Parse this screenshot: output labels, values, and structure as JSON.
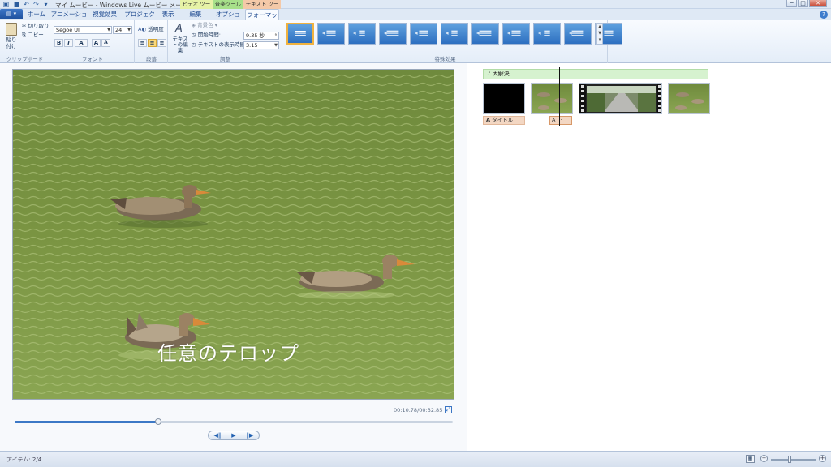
{
  "titlebar": {
    "title": "マイ ムービー - Windows Live ムービー メーカー",
    "context_tools": [
      {
        "label": "ビデオ ツール",
        "color": "#e6f2a6"
      },
      {
        "label": "音楽ツール",
        "color": "#a7e08a"
      },
      {
        "label": "テキスト ツール",
        "color": "#f4c9a8"
      }
    ],
    "window_buttons": {
      "minimize": "─",
      "maximize": "□",
      "close": "✕"
    }
  },
  "quick_access": [
    {
      "icon": "save-icon",
      "glyph": "■"
    },
    {
      "icon": "undo-icon",
      "glyph": "↶"
    },
    {
      "icon": "redo-icon",
      "glyph": "↷"
    },
    {
      "icon": "customize-icon",
      "glyph": "▾"
    }
  ],
  "tabs": {
    "file_glyph": "▤ ▾",
    "items": [
      {
        "label": "ホーム"
      },
      {
        "label": "アニメーション"
      },
      {
        "label": "視覚効果"
      },
      {
        "label": "プロジェクト"
      },
      {
        "label": "表示"
      },
      {
        "label": "編集"
      },
      {
        "label": "オプション"
      },
      {
        "label": "フォーマット"
      }
    ],
    "active": "フォーマット",
    "help": "?"
  },
  "ribbon": {
    "clipboard": {
      "paste": "貼り付け",
      "cut": "切り取り",
      "copy": "コピー",
      "label": "クリップボード"
    },
    "font": {
      "family": "Segoe UI",
      "size": "24",
      "bold": "B",
      "italic": "I",
      "color": "A",
      "grow": "A",
      "shrink": "A",
      "label": "フォント"
    },
    "paragraph": {
      "transparency": "透明度",
      "label": "段落"
    },
    "adjust": {
      "edit_text": "テキストの編集",
      "background_color": "背景色",
      "start_time_label": "開始時間:",
      "start_time_value": "9.35 秒",
      "duration_label": "テキストの表示時間:",
      "duration_value": "3.15",
      "label": "調整"
    },
    "effects": {
      "label": "特殊効果",
      "count": 11,
      "selected_index": 0
    }
  },
  "preview": {
    "caption": "任意のテロップ",
    "timecode": "00:10.78/00:32.85",
    "progress": 0.328,
    "transport": {
      "prev": "◀‖",
      "play": "▶",
      "next": "‖▶"
    }
  },
  "storyboard": {
    "music_label": "♪ 大解決",
    "title_clip": "タイトル",
    "text_clip": "A ···"
  },
  "statusbar": {
    "item_count": "アイテム: 2/4",
    "zoom_out": "−",
    "zoom_in": "+",
    "zoom_level": 0.38
  }
}
